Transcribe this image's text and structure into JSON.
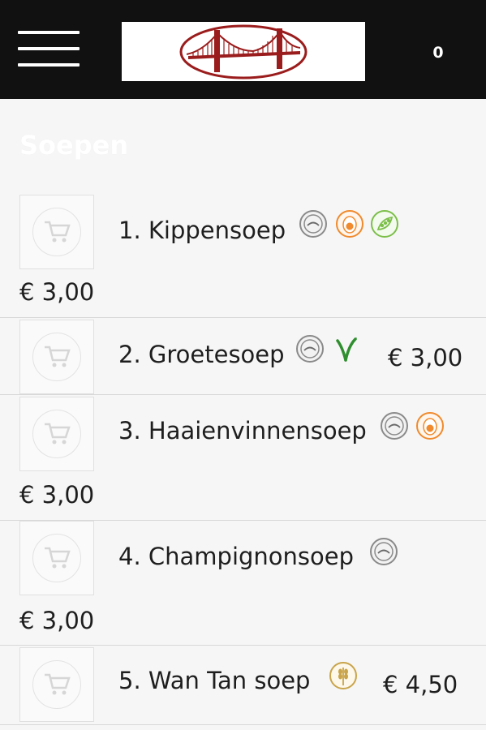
{
  "header": {
    "menu_icon": "hamburger-menu-icon",
    "logo_icon": "golden-gate-bridge-logo",
    "cart_count": "0",
    "colors": {
      "bar": "#111111",
      "logo_red": "#9b1c1c"
    }
  },
  "section": {
    "title": "Soepen"
  },
  "items": [
    {
      "name": "1. Kippensoep",
      "price": "€ 3,00",
      "badges": [
        "halal-icon",
        "egg-icon",
        "soy-icon"
      ]
    },
    {
      "name": "2. Groetesoep",
      "price": "€ 3,00",
      "badges": [
        "halal-icon",
        "vegetarian-icon"
      ]
    },
    {
      "name": "3. Haaienvinnensoep",
      "price": "€ 3,00",
      "badges": [
        "halal-icon",
        "egg-icon"
      ]
    },
    {
      "name": "4. Champignonsoep",
      "price": "€ 3,00",
      "badges": [
        "halal-icon"
      ]
    },
    {
      "name": "5. Wan Tan soep",
      "price": "€ 4,50",
      "badges": [
        "gluten-icon"
      ]
    }
  ],
  "icon_colors": {
    "halal": "#8a8a8a",
    "egg": "#f08a2c",
    "soy": "#7cbf4a",
    "vegetarian": "#2f8f2f",
    "gluten": "#c9a44a"
  }
}
